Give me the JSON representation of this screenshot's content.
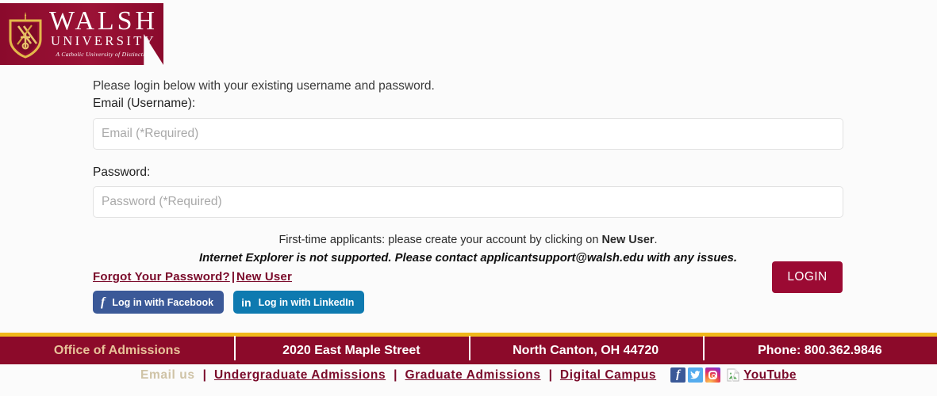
{
  "brand": {
    "name_line1": "WALSH",
    "name_line2": "UNIVERSITY",
    "tagline": "A Catholic University of Distinction",
    "maroon": "#8c0a2a",
    "gold": "#f0b81b"
  },
  "form": {
    "intro": "Please login below with your existing username and password.",
    "email_label": "Email (Username):",
    "email_placeholder": "Email (*Required)",
    "email_value": "",
    "password_label": "Password:",
    "password_placeholder": "Password (*Required)",
    "password_value": "",
    "note_line1_a": "First-time applicants: please create your account by clicking on ",
    "note_line1_b": "New User",
    "note_line1_c": ".",
    "note_line2": "Internet Explorer is not supported.  Please contact applicantsupport@walsh.edu with any issues.",
    "forgot_password": "Forgot Your Password?",
    "separator": "|",
    "new_user": "New User",
    "facebook_button": "Log in with Facebook",
    "facebook_glyph": "f",
    "linkedin_button": "Log in with LinkedIn",
    "linkedin_glyph": "in",
    "login_button": "LOGIN"
  },
  "footer": {
    "cells": [
      "Office of Admissions",
      "2020 East Maple Street",
      "North Canton, OH 44720",
      "Phone: 800.362.9846"
    ]
  },
  "bottom": {
    "email_us": "Email us",
    "sep": "|",
    "links": [
      "Undergraduate Admissions",
      "Graduate Admissions",
      "Digital Campus"
    ],
    "youtube_alt": "YouTube",
    "social": [
      "facebook-icon",
      "twitter-icon",
      "instagram-icon",
      "youtube-broken-image-icon"
    ]
  }
}
